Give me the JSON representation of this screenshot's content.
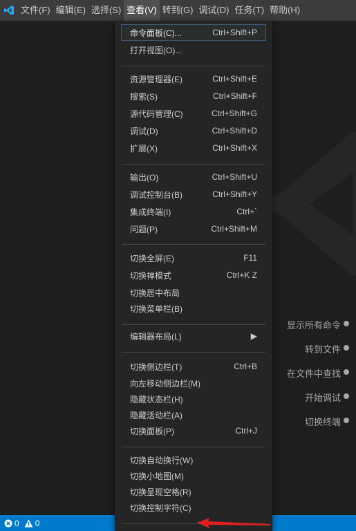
{
  "menubar": {
    "items": [
      "文件(F)",
      "编辑(E)",
      "选择(S)",
      "查看(V)",
      "转到(G)",
      "调试(D)",
      "任务(T)",
      "帮助(H)"
    ]
  },
  "view_menu": {
    "items": [
      {
        "label": "命令面板(C)...",
        "shortcut": "Ctrl+Shift+P"
      },
      {
        "label": "打开视图(O)...",
        "shortcut": ""
      },
      {
        "label": "资源管理器(E)",
        "shortcut": "Ctrl+Shift+E"
      },
      {
        "label": "搜索(S)",
        "shortcut": "Ctrl+Shift+F"
      },
      {
        "label": "源代码管理(C)",
        "shortcut": "Ctrl+Shift+G"
      },
      {
        "label": "调试(D)",
        "shortcut": "Ctrl+Shift+D"
      },
      {
        "label": "扩展(X)",
        "shortcut": "Ctrl+Shift+X"
      },
      {
        "label": "输出(O)",
        "shortcut": "Ctrl+Shift+U"
      },
      {
        "label": "调试控制台(B)",
        "shortcut": "Ctrl+Shift+Y"
      },
      {
        "label": "集成终端(I)",
        "shortcut": "Ctrl+`"
      },
      {
        "label": "问题(P)",
        "shortcut": "Ctrl+Shift+M"
      },
      {
        "label": "切换全屏(E)",
        "shortcut": "F11"
      },
      {
        "label": "切换禅模式",
        "shortcut": "Ctrl+K Z"
      },
      {
        "label": "切换居中布局",
        "shortcut": ""
      },
      {
        "label": "切换菜单栏(B)",
        "shortcut": ""
      },
      {
        "label": "编辑器布局(L)",
        "shortcut": "▶"
      },
      {
        "label": "切换侧边栏(T)",
        "shortcut": "Ctrl+B"
      },
      {
        "label": "向左移动侧边栏(M)",
        "shortcut": ""
      },
      {
        "label": "隐藏状态栏(H)",
        "shortcut": ""
      },
      {
        "label": "隐藏活动栏(A)",
        "shortcut": ""
      },
      {
        "label": "切换面板(P)",
        "shortcut": "Ctrl+J"
      },
      {
        "label": "切换自动换行(W)",
        "shortcut": ""
      },
      {
        "label": "切换小地图(M)",
        "shortcut": ""
      },
      {
        "label": "切换呈现空格(R)",
        "shortcut": ""
      },
      {
        "label": "切换控制字符(C)",
        "shortcut": ""
      }
    ]
  },
  "welcome_hints": [
    "显示所有命令",
    "转到文件",
    "在文件中查找",
    "开始调试",
    "切换终端"
  ],
  "statusbar": {
    "errors": "0",
    "warnings": "0"
  },
  "colors": {
    "accent": "#007acc",
    "menubar": "#3c3c3c",
    "menu_bg": "#252526",
    "annotation_arrow": "#e02020"
  }
}
